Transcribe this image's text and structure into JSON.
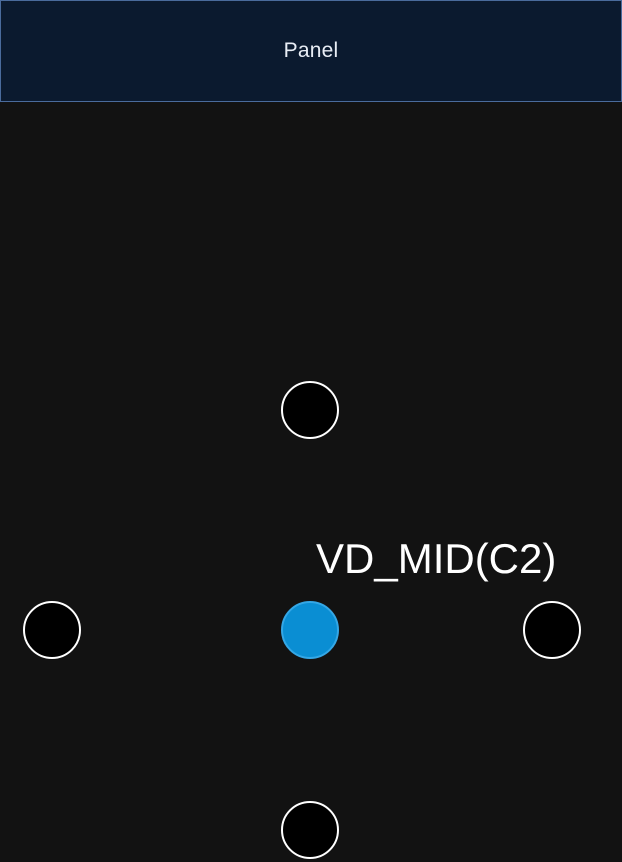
{
  "header": {
    "title": "Panel"
  },
  "navigator": {
    "selected_label": "VD_MID(C2)",
    "colors": {
      "background": "#121212",
      "header_bg": "#0b1a2f",
      "header_border": "#4a6b9c",
      "node_fill": "#000000",
      "node_border": "#ffffff",
      "active_fill": "#0a8ed3"
    }
  }
}
